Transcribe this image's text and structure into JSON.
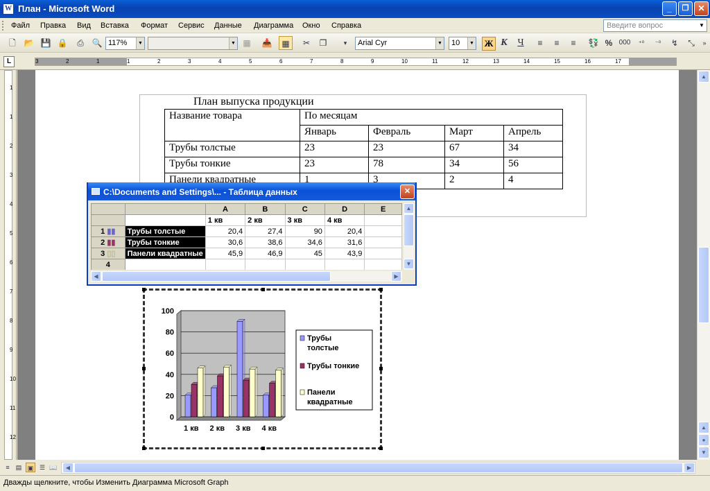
{
  "window": {
    "title": "План - Microsoft Word",
    "icon": "W",
    "minimize": "_",
    "maximize": "❐",
    "close": "✕"
  },
  "menu": {
    "items": [
      "Файл",
      "Правка",
      "Вид",
      "Вставка",
      "Формат",
      "Сервис",
      "Данные",
      "Диаграмма",
      "Окно",
      "Справка"
    ],
    "ask_placeholder": "Введите вопрос"
  },
  "toolbar": {
    "zoom": "117%",
    "font": "Arial Cyr",
    "size": "10",
    "bold": "Ж",
    "italic": "К",
    "underline": "Ч",
    "percent": "%",
    "thousands": "000"
  },
  "ruler": {
    "selector": "L",
    "numbers": [
      "3",
      "2",
      "1",
      "1",
      "2",
      "3",
      "4",
      "5",
      "6",
      "7",
      "8",
      "9",
      "10",
      "11",
      "12",
      "13",
      "14",
      "15",
      "16",
      "17"
    ],
    "vnumbers": [
      "1",
      "1",
      "2",
      "3",
      "4",
      "5",
      "6",
      "7",
      "8",
      "9",
      "10",
      "11",
      "12"
    ]
  },
  "document": {
    "caption": "План выпуска продукции",
    "table": {
      "head1": [
        "Название товара",
        "По месяцам"
      ],
      "months": [
        "Январь",
        "Февраль",
        "Март",
        "Апрель"
      ],
      "rows": [
        {
          "name": "Трубы толстые",
          "vals": [
            "23",
            "23",
            "67",
            "34"
          ]
        },
        {
          "name": "Трубы тонкие",
          "vals": [
            "23",
            "78",
            "34",
            "56"
          ]
        },
        {
          "name": "Панели квадратные",
          "vals": [
            "1",
            "3",
            "2",
            "4"
          ]
        }
      ]
    }
  },
  "datasheet": {
    "title": "C:\\Documents and Settings\\... - Таблица данных",
    "close": "✕",
    "cols": [
      "A",
      "B",
      "C",
      "D",
      "E"
    ],
    "col_headers": [
      "1 кв",
      "2 кв",
      "3 кв",
      "4 кв"
    ],
    "rows": [
      {
        "num": "1",
        "label": "Трубы толстые",
        "vals": [
          "20,4",
          "27,4",
          "90",
          "20,4"
        ]
      },
      {
        "num": "2",
        "label": "Трубы тонкие",
        "vals": [
          "30,6",
          "38,6",
          "34,6",
          "31,6"
        ]
      },
      {
        "num": "3",
        "label": "Панели квадратные",
        "vals": [
          "45,9",
          "46,9",
          "45",
          "43,9"
        ]
      },
      {
        "num": "4",
        "label": "",
        "vals": [
          "",
          "",
          "",
          ""
        ]
      }
    ]
  },
  "chart_data": {
    "type": "bar",
    "categories": [
      "1 кв",
      "2 кв",
      "3 кв",
      "4 кв"
    ],
    "series": [
      {
        "name": "Трубы толстые",
        "values": [
          20.4,
          27.4,
          90,
          20.4
        ],
        "color": "#9999ff"
      },
      {
        "name": "Трубы тонкие",
        "values": [
          30.6,
          38.6,
          34.6,
          31.6
        ],
        "color": "#993366"
      },
      {
        "name": "Панели квадратные",
        "values": [
          45.9,
          46.9,
          45,
          43.9
        ],
        "color": "#ffffcc"
      }
    ],
    "ylim": [
      0,
      100
    ],
    "yticks": [
      "0",
      "20",
      "40",
      "60",
      "80",
      "100"
    ],
    "grid": true,
    "legend": "right",
    "legend_labels": [
      [
        "Трубы",
        "толстые"
      ],
      [
        "Трубы тонкие"
      ],
      [
        "Панели",
        "квадратные"
      ]
    ],
    "plot_bg": "#c0c0c0"
  },
  "status": {
    "text": "Дважды щелкните, чтобы Изменить Диаграмма Microsoft Graph"
  }
}
